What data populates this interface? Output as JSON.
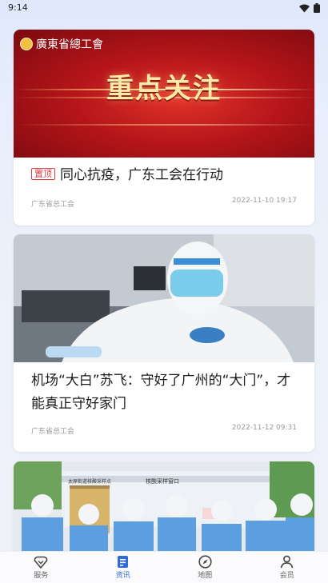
{
  "status_bar": {
    "time": "9:14"
  },
  "feed": [
    {
      "banner_logo": "廣東省總工會",
      "banner_headline": "重点关注",
      "tag": "置顶",
      "title": "同心抗疫，广东工会在行动",
      "source": "广东省总工会",
      "time": "2022-11-10 19:17"
    },
    {
      "title": "机场“大白”苏飞：守好了广州的“大门”，才能真正守好家门",
      "source": "广东省总工会",
      "time": "2022-11-12 09:31"
    },
    {
      "sign_left": "太原街道核酸采样点",
      "sign_right": "核酸采样窗口"
    }
  ],
  "tabbar": {
    "items": [
      {
        "label": "服务",
        "icon": "heart-diamond-icon"
      },
      {
        "label": "资讯",
        "icon": "news-icon",
        "active": true
      },
      {
        "label": "地图",
        "icon": "compass-icon"
      },
      {
        "label": "会员",
        "icon": "person-icon"
      }
    ]
  },
  "colors": {
    "accent": "#2f6bd6",
    "tag_red": "#e23b3b"
  }
}
